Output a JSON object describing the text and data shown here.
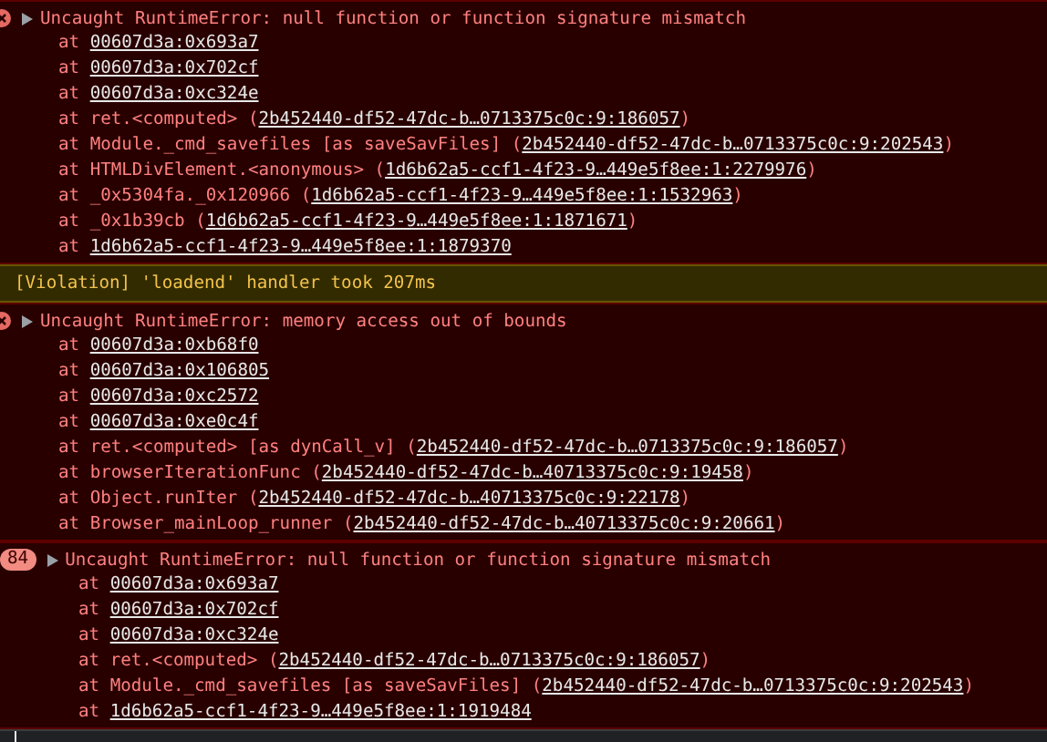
{
  "console": {
    "entries": [
      {
        "kind": "error",
        "message": "Uncaught RuntimeError: null function or function signature mismatch",
        "frames": [
          {
            "pre": "at ",
            "link": "00607d3a:0x693a7"
          },
          {
            "pre": "at ",
            "link": "00607d3a:0x702cf"
          },
          {
            "pre": "at ",
            "link": "00607d3a:0xc324e"
          },
          {
            "pre": "at ret.<computed> (",
            "link": "2b452440-df52-47dc-b…0713375c0c:9:186057",
            "post": ")"
          },
          {
            "pre": "at Module._cmd_savefiles [as saveSavFiles] (",
            "link": "2b452440-df52-47dc-b…0713375c0c:9:202543",
            "post": ")"
          },
          {
            "pre": "at HTMLDivElement.<anonymous> (",
            "link": "1d6b62a5-ccf1-4f23-9…449e5f8ee:1:2279976",
            "post": ")"
          },
          {
            "pre": "at _0x5304fa._0x120966 (",
            "link": "1d6b62a5-ccf1-4f23-9…449e5f8ee:1:1532963",
            "post": ")"
          },
          {
            "pre": "at _0x1b39cb (",
            "link": "1d6b62a5-ccf1-4f23-9…449e5f8ee:1:1871671",
            "post": ")"
          },
          {
            "pre": "at ",
            "link": "1d6b62a5-ccf1-4f23-9…449e5f8ee:1:1879370"
          }
        ]
      },
      {
        "kind": "violation",
        "message": "[Violation] 'loadend' handler took 207ms"
      },
      {
        "kind": "error",
        "message": "Uncaught RuntimeError: memory access out of bounds",
        "frames": [
          {
            "pre": "at ",
            "link": "00607d3a:0xb68f0"
          },
          {
            "pre": "at ",
            "link": "00607d3a:0x106805"
          },
          {
            "pre": "at ",
            "link": "00607d3a:0xc2572"
          },
          {
            "pre": "at ",
            "link": "00607d3a:0xe0c4f"
          },
          {
            "pre": "at ret.<computed> [as dynCall_v] (",
            "link": "2b452440-df52-47dc-b…0713375c0c:9:186057",
            "post": ")"
          },
          {
            "pre": "at browserIterationFunc (",
            "link": "2b452440-df52-47dc-b…40713375c0c:9:19458",
            "post": ")"
          },
          {
            "pre": "at Object.runIter (",
            "link": "2b452440-df52-47dc-b…40713375c0c:9:22178",
            "post": ")"
          },
          {
            "pre": "at Browser_mainLoop_runner (",
            "link": "2b452440-df52-47dc-b…40713375c0c:9:20661",
            "post": ")"
          }
        ]
      },
      {
        "kind": "error",
        "count": "84",
        "message": "Uncaught RuntimeError: null function or function signature mismatch",
        "frames": [
          {
            "pre": "at ",
            "link": "00607d3a:0x693a7"
          },
          {
            "pre": "at ",
            "link": "00607d3a:0x702cf"
          },
          {
            "pre": "at ",
            "link": "00607d3a:0xc324e"
          },
          {
            "pre": "at ret.<computed> (",
            "link": "2b452440-df52-47dc-b…0713375c0c:9:186057",
            "post": ")"
          },
          {
            "pre": "at Module._cmd_savefiles [as saveSavFiles] (",
            "link": "2b452440-df52-47dc-b…0713375c0c:9:202543",
            "post": ")"
          },
          {
            "pre": "at ",
            "link": "1d6b62a5-ccf1-4f23-9…449e5f8ee:1:1919484"
          }
        ]
      }
    ]
  }
}
